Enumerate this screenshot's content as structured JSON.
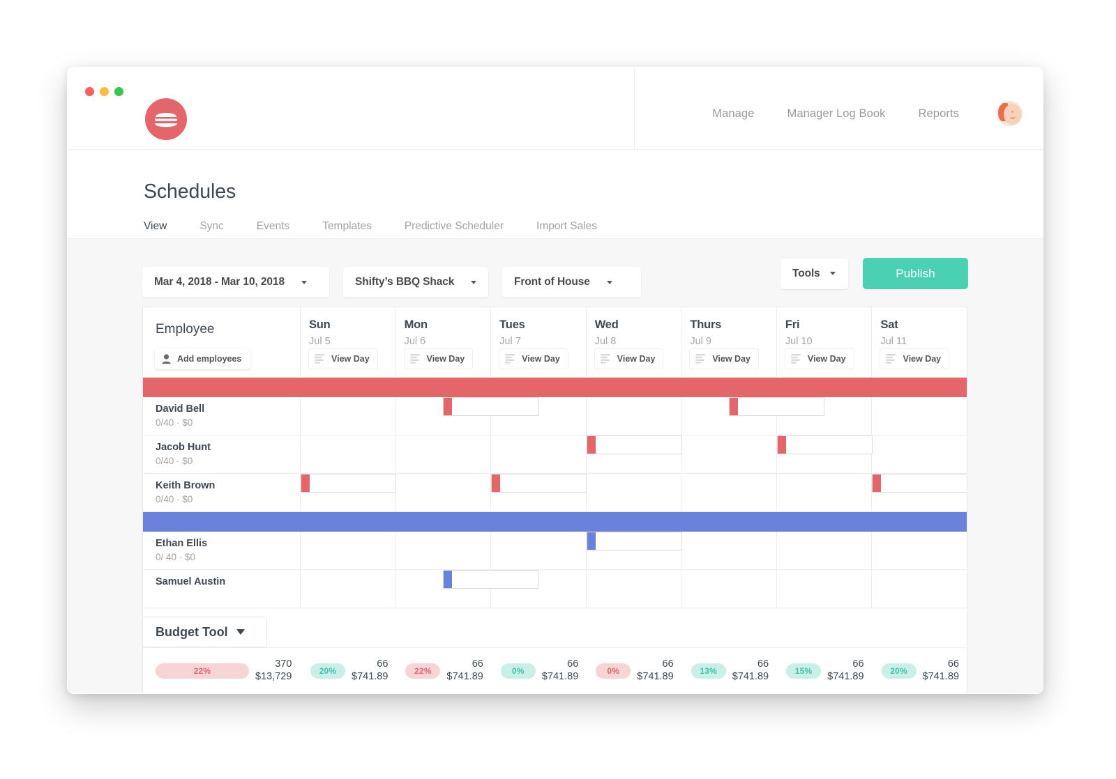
{
  "window": {
    "traffic_lights": [
      "close",
      "minimize",
      "maximize"
    ],
    "logo_name": "burger-logo"
  },
  "topnav": {
    "items": [
      {
        "label": "Manage",
        "name": "manage"
      },
      {
        "label": "Manager Log Book",
        "name": "manager-log-book"
      },
      {
        "label": "Reports",
        "name": "reports"
      }
    ],
    "avatar_name": "user-avatar"
  },
  "page": {
    "title": "Schedules",
    "tabs": [
      {
        "label": "View",
        "active": true
      },
      {
        "label": "Sync",
        "active": false
      },
      {
        "label": "Events",
        "active": false
      },
      {
        "label": "Templates",
        "active": false
      },
      {
        "label": "Predictive Scheduler",
        "active": false
      },
      {
        "label": "Import Sales",
        "active": false
      }
    ]
  },
  "toolbar": {
    "date_range": "Mar 4, 2018 - Mar 10, 2018",
    "location": "Shifty’s BBQ Shack",
    "department": "Front of House",
    "tools_label": "Tools",
    "publish_label": "Publish",
    "publish_color": "#4ad1b3"
  },
  "schedule": {
    "employee_header": "Employee",
    "add_employees_label": "Add employees",
    "view_day_label": "View Day",
    "days": [
      {
        "name": "Sun",
        "date": "Jul 5"
      },
      {
        "name": "Mon",
        "date": "Jul 6"
      },
      {
        "name": "Tues",
        "date": "Jul 7"
      },
      {
        "name": "Wed",
        "date": "Jul 8"
      },
      {
        "name": "Thurs",
        "date": "Jul 9"
      },
      {
        "name": "Fri",
        "date": "Jul 10"
      },
      {
        "name": "Sat",
        "date": "Jul 11"
      }
    ],
    "groups": [
      {
        "color": "#e4666a",
        "color_name": "red",
        "employees": [
          {
            "name": "David Bell",
            "hours": "0/40 · $0"
          },
          {
            "name": "Jacob Hunt",
            "hours": "0/40 · $0"
          },
          {
            "name": "Keith Brown",
            "hours": "0/40 · $0"
          }
        ]
      },
      {
        "color": "#6b82dd",
        "color_name": "blue",
        "employees": [
          {
            "name": "Ethan Ellis",
            "hours": "0/ 40 · $0"
          },
          {
            "name": "Samuel Austin",
            "hours": ""
          }
        ]
      }
    ]
  },
  "budget": {
    "tab_label": "Budget Tool",
    "columns": [
      {
        "pct": "22%",
        "status": "over",
        "hours": "370",
        "amount": "$13,729",
        "wide": true
      },
      {
        "pct": "20%",
        "status": "under",
        "hours": "66",
        "amount": "$741.89",
        "wide": false
      },
      {
        "pct": "22%",
        "status": "over",
        "hours": "66",
        "amount": "$741.89",
        "wide": false
      },
      {
        "pct": "0%",
        "status": "under",
        "hours": "66",
        "amount": "$741.89",
        "wide": false
      },
      {
        "pct": "0%",
        "status": "over",
        "hours": "66",
        "amount": "$741.89",
        "wide": false
      },
      {
        "pct": "13%",
        "status": "under",
        "hours": "66",
        "amount": "$741.89",
        "wide": false
      },
      {
        "pct": "15%",
        "status": "under",
        "hours": "66",
        "amount": "$741.89",
        "wide": false
      },
      {
        "pct": "20%",
        "status": "under",
        "hours": "66",
        "amount": "$741.89",
        "wide": false
      }
    ]
  },
  "shifts": [
    {
      "row": 0,
      "group": "red",
      "day": 1,
      "half": "right"
    },
    {
      "row": 0,
      "group": "red",
      "day": 4,
      "half": "right"
    },
    {
      "row": 1,
      "group": "red",
      "day": 3,
      "half": "left"
    },
    {
      "row": 1,
      "group": "red",
      "day": 5,
      "half": "left"
    },
    {
      "row": 2,
      "group": "red",
      "day": 0,
      "half": "left"
    },
    {
      "row": 2,
      "group": "red",
      "day": 2,
      "half": "left"
    },
    {
      "row": 2,
      "group": "red",
      "day": 6,
      "half": "left"
    },
    {
      "row": 3,
      "group": "blue",
      "day": 3,
      "half": "left"
    },
    {
      "row": 4,
      "group": "blue",
      "day": 1,
      "half": "right"
    }
  ]
}
